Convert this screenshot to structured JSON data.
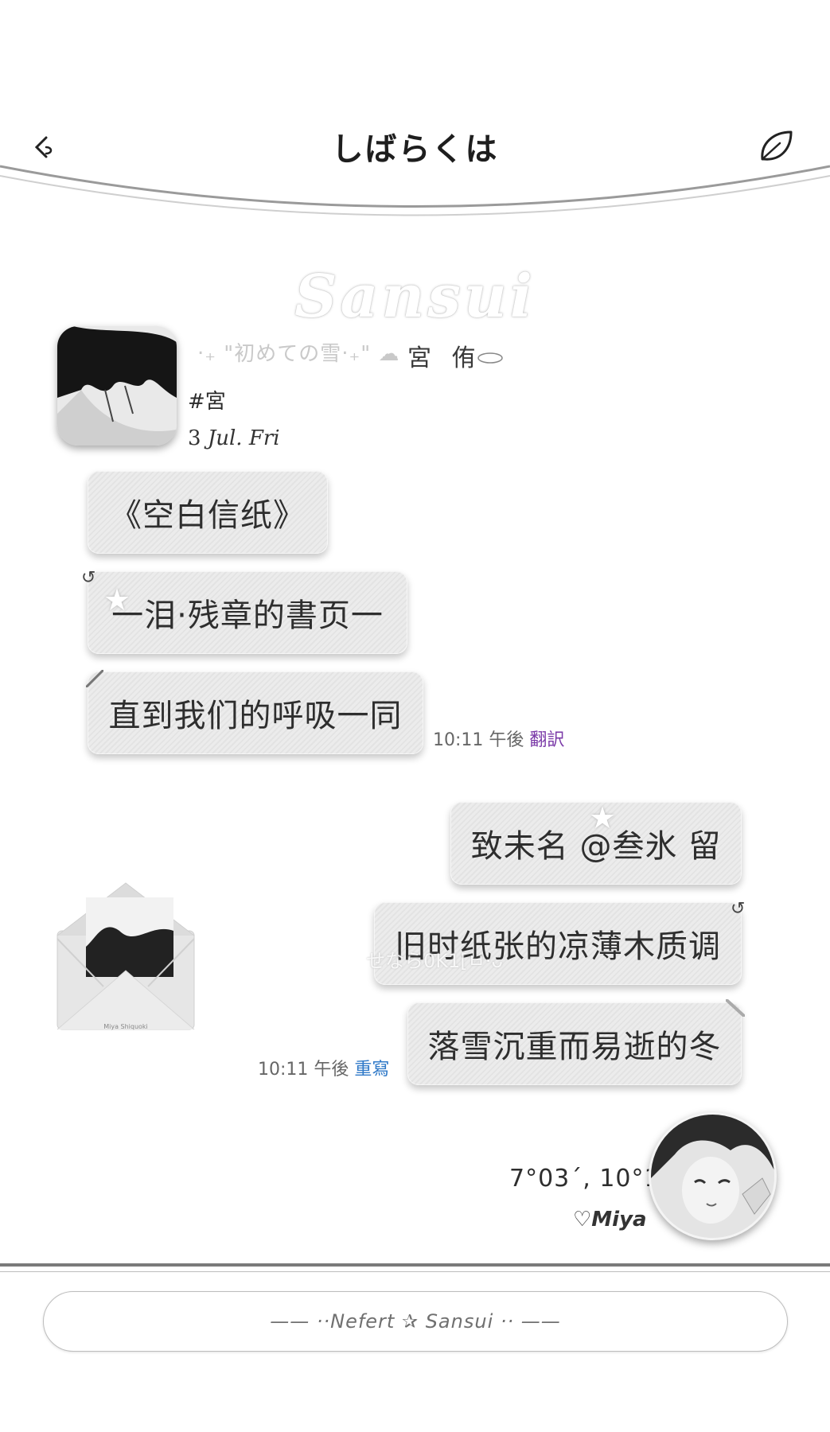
{
  "header": {
    "title": "しばらくは"
  },
  "watermark": "Sansui",
  "profile": {
    "deco": "‧₊ \"初めての雪‧₊\" ☁",
    "name": "宮 侑",
    "tag": "#宮",
    "date_day": "3",
    "date_text": "Jul. Fri"
  },
  "messages_left": [
    {
      "text": "《空白信纸》"
    },
    {
      "text": "一泪·残章的書页一"
    },
    {
      "text": "直到我们的呼吸一同"
    }
  ],
  "meta_left": {
    "time": "10:11 午後",
    "action": "翻訳"
  },
  "messages_right": [
    {
      "text": "致未名 @叁氷 留"
    },
    {
      "text": "旧时纸张的凉薄木质调"
    },
    {
      "text": "落雪沉重而易逝的冬"
    }
  ],
  "meta_right": {
    "time": "10:11 午後",
    "action": "重寫"
  },
  "overlay_text": "せなら0K1[ㅂ·ᴗ",
  "envelope_label": "Miya Shiquoki",
  "coords": "7°03´, 10°11",
  "signature": "♡Miya",
  "input": {
    "placeholder": "—— ··Nefert ✰ Sansui ·· ——"
  },
  "colors": {
    "accent_purple": "#7b3aa8",
    "accent_blue": "#2f79c8",
    "bubble": "#e8e8e8"
  }
}
